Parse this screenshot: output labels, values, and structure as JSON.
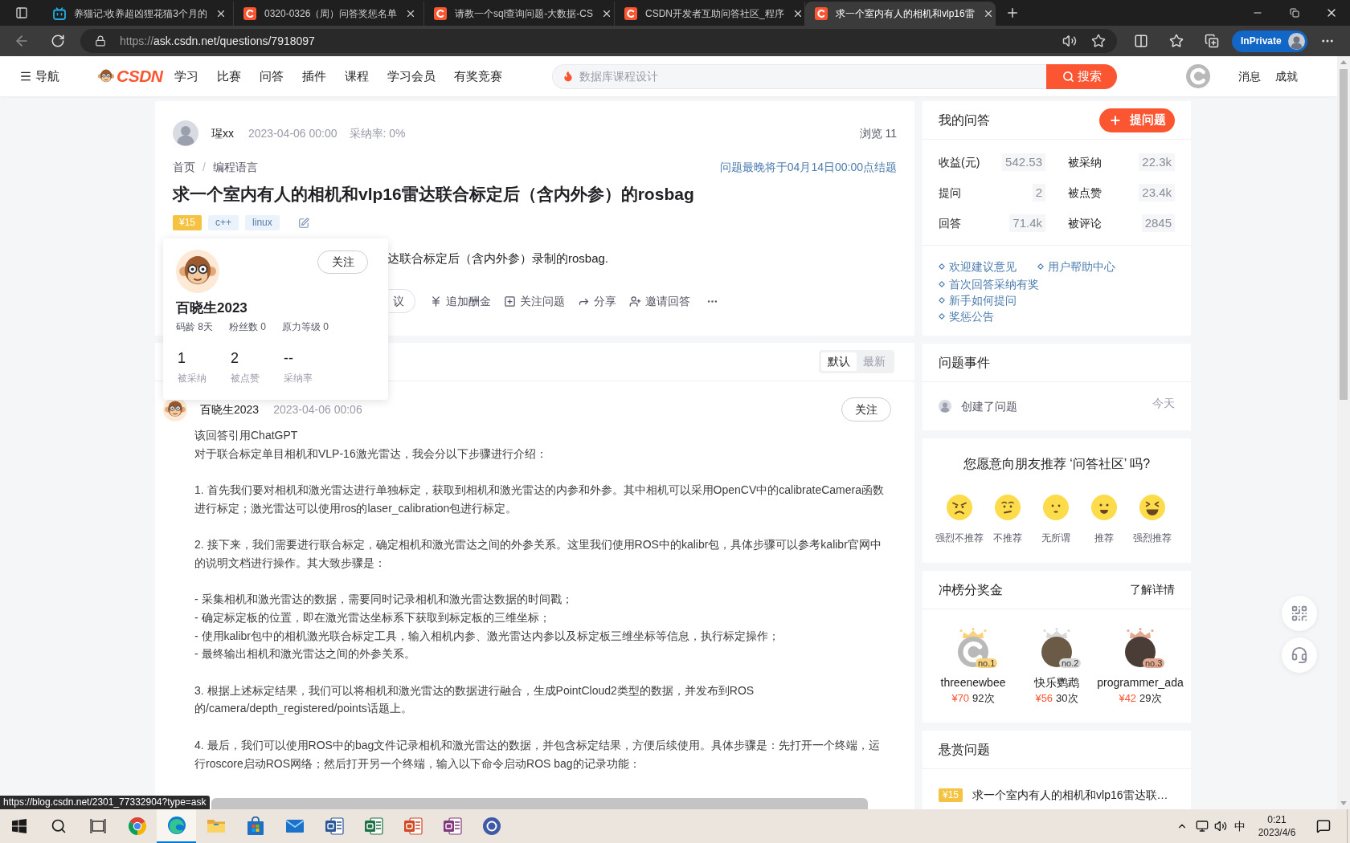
{
  "browser": {
    "tabs": [
      {
        "title": "养猫记:收养超凶狸花猫3个月的",
        "kind": "tv",
        "selected": false
      },
      {
        "title": "0320-0326（周）问答奖惩名单",
        "kind": "logo",
        "selected": false
      },
      {
        "title": "请教一个sql查询问题-大数据-CS",
        "kind": "logo",
        "selected": false
      },
      {
        "title": "CSDN开发者互助问答社区_程序",
        "kind": "logo",
        "selected": false
      },
      {
        "title": "求一个室内有人的相机和vlp16雷",
        "kind": "logo",
        "selected": true
      }
    ],
    "url_scheme": "https://",
    "url_rest": "ask.csdn.net/questions/7918097",
    "profile": "InPrivate"
  },
  "site_nav": {
    "menu": "导航",
    "logo": "CSDN",
    "links": [
      "学习",
      "比赛",
      "问答",
      "插件",
      "课程",
      "学习会员",
      "有奖竞赛"
    ],
    "search_placeholder": "数据库课程设计",
    "search_button": "搜索",
    "right_links": [
      "消息",
      "成就"
    ]
  },
  "question": {
    "author": "瑆xx",
    "date": "2023-04-06 00:00",
    "accept_rate": "采纳率: 0%",
    "views": "浏览 11",
    "breadcrumb": [
      "首页",
      "编程语言"
    ],
    "breadcrumb_separator": "/",
    "deadline": "问题最晚将于04月14日00:00点结题",
    "title": "求一个室内有人的相机和vlp16雷达联合标定后（含内外参）的rosbag",
    "bounty": "¥15",
    "tags": [
      "c++",
      "linux"
    ],
    "body": "达联合标定后（含内外参）录制的rosbag.",
    "actions": [
      {
        "kind": "suggest",
        "label": "议"
      },
      {
        "kind": "reward",
        "label": "追加酬金"
      },
      {
        "kind": "follow",
        "label": "关注问题"
      },
      {
        "kind": "share",
        "label": "分享"
      },
      {
        "kind": "invite",
        "label": "邀请回答"
      }
    ]
  },
  "answers": {
    "sort": [
      {
        "label": "默认",
        "selected": true
      },
      {
        "label": "最新",
        "selected": false
      }
    ],
    "items": [
      {
        "author": "百晓生2023",
        "date": "2023-04-06 00:06",
        "follow": "关注",
        "blocks": [
          [
            "该回答引用ChatGPT",
            "对于联合标定单目相机和VLP-16激光雷达，我会分以下步骤进行介绍："
          ],
          [
            "1. 首先我们要对相机和激光雷达进行单独标定，获取到相机和激光雷达的内参和外参。其中相机可以采用OpenCV中的calibrateCamera函数进行标定；激光雷达可以使用ros的laser_calibration包进行标定。"
          ],
          [
            "2. 接下来，我们需要进行联合标定，确定相机和激光雷达之间的外参关系。这里我们使用ROS中的kalibr包，具体步骤可以参考kalibr官网中的说明文档进行操作。其大致步骤是："
          ],
          [
            "- 采集相机和激光雷达的数据，需要同时记录相机和激光雷达数据的时间戳；",
            "- 确定标定板的位置，即在激光雷达坐标系下获取到标定板的三维坐标；",
            "- 使用kalibr包中的相机激光联合标定工具，输入相机内参、激光雷达内参以及标定板三维坐标等信息，执行标定操作；",
            "- 最终输出相机和激光雷达之间的外参关系。"
          ],
          [
            "3. 根据上述标定结果，我们可以将相机和激光雷达的数据进行融合，生成PointCloud2类型的数据，并发布到ROS的/camera/depth_registered/points话题上。"
          ],
          [
            "4. 最后，我们可以使用ROS中的bag文件记录相机和激光雷达的数据，并包含标定结果，方便后续使用。具体步骤是：先打开一个终端，运行roscore启动ROS网络；然后打开另一个终端，输入以下命令启动ROS bag的记录功能："
          ]
        ]
      }
    ]
  },
  "user_card": {
    "name": "百晓生2023",
    "follow": "关注",
    "meta": [
      "码龄 8天",
      "粉丝数 0",
      "原力等级 0"
    ],
    "stats": [
      {
        "value": "1",
        "label": "被采纳"
      },
      {
        "value": "2",
        "label": "被点赞"
      },
      {
        "value": "--",
        "label": "采纳率"
      }
    ]
  },
  "my_qa": {
    "title": "我的问答",
    "ask_button": "提问题",
    "stats": [
      {
        "label": "收益(元)",
        "value": "542.53"
      },
      {
        "label": "被采纳",
        "value": "22.3k"
      },
      {
        "label": "提问",
        "value": "2"
      },
      {
        "label": "被点赞",
        "value": "23.4k"
      },
      {
        "label": "回答",
        "value": "71.4k"
      },
      {
        "label": "被评论",
        "value": "2845"
      }
    ],
    "link_rows": [
      [
        "欢迎建议意见",
        "用户帮助中心"
      ],
      [
        "首次回答采纳有奖"
      ],
      [
        "新手如何提问"
      ],
      [
        "奖惩公告"
      ]
    ]
  },
  "events": {
    "title": "问题事件",
    "items": [
      {
        "text": "创建了问题",
        "time": "今天"
      }
    ]
  },
  "recommend": {
    "title": "您愿意向朋友推荐 ‘问答社区’ 吗?",
    "options": [
      {
        "label": "强烈不推荐",
        "kind": "angry"
      },
      {
        "label": "不推荐",
        "kind": "unhappy"
      },
      {
        "label": "无所谓",
        "kind": "neutral"
      },
      {
        "label": "推荐",
        "kind": "smile"
      },
      {
        "label": "强烈推荐",
        "kind": "laugh"
      }
    ]
  },
  "leaderboard": {
    "title": "冲榜分奖金",
    "more": "了解详情",
    "users": [
      {
        "name": "threenewbee",
        "rank": "no.1",
        "amount": "¥70",
        "count": "92次",
        "color": "#f9d27d",
        "kind": "logo"
      },
      {
        "name": "快乐鹦鹉",
        "rank": "no.2",
        "amount": "¥56",
        "count": "30次",
        "color": "#d9d9d9",
        "kind": "photo"
      },
      {
        "name": "programmer_ada",
        "rank": "no.3",
        "amount": "¥42",
        "count": "29次",
        "color": "#e4aa93",
        "kind": "photo"
      }
    ]
  },
  "bounty_questions": {
    "title": "悬赏问题",
    "items": [
      {
        "bounty": "¥15",
        "title": "求一个室内有人的相机和vlp16雷达联…"
      }
    ]
  },
  "status_url": "https://blog.csdn.net/2301_77332904?type=ask",
  "taskbar": {
    "apps": [
      {
        "kind": "chrome",
        "selected": false
      },
      {
        "kind": "edge",
        "selected": true
      },
      {
        "kind": "explorer",
        "selected": false
      },
      {
        "kind": "store",
        "selected": false
      },
      {
        "kind": "mail",
        "selected": false
      },
      {
        "kind": "word",
        "selected": false
      },
      {
        "kind": "excel",
        "selected": false
      },
      {
        "kind": "powerpoint",
        "selected": false
      },
      {
        "kind": "onenote",
        "selected": false
      },
      {
        "kind": "app",
        "selected": false
      }
    ],
    "ime": "中",
    "time": "0:21",
    "date": "2023/4/6"
  }
}
